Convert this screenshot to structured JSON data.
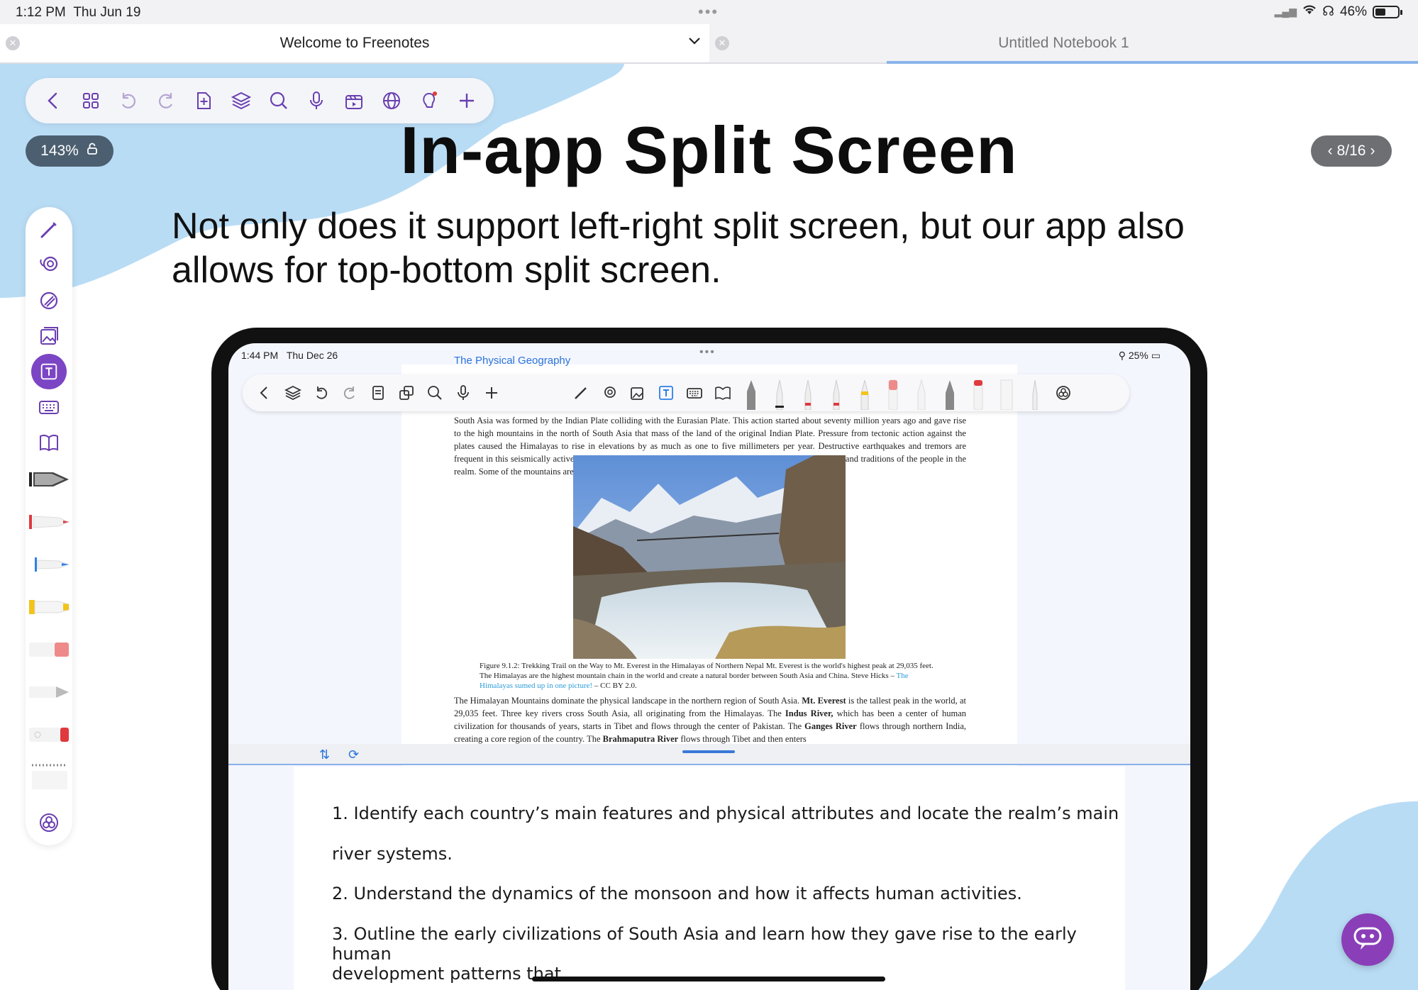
{
  "status_bar": {
    "time": "1:12 PM",
    "date": "Thu Jun 19",
    "battery": "46%"
  },
  "tabs": [
    {
      "label": "Welcome to Freenotes",
      "active": true
    },
    {
      "label": "Untitled Notebook 1",
      "active": false
    }
  ],
  "toolbar": {
    "icons": [
      "back-icon",
      "grid-icon",
      "undo-icon",
      "redo-icon",
      "add-page-icon",
      "layers-icon",
      "search-icon",
      "microphone-icon",
      "video-icon",
      "globe-icon",
      "lightbulb-icon",
      "plus-icon"
    ]
  },
  "zoom": {
    "label": "143%"
  },
  "page_indicator": {
    "label": "8/16"
  },
  "sidebar": {
    "icons": [
      "pen-icon",
      "lasso-icon",
      "shape-icon",
      "image-icon",
      "text-box-icon",
      "keyboard-icon",
      "book-icon",
      "fountain-pen-icon",
      "red-marker-icon",
      "blue-marker-icon",
      "yellow-highlighter-icon",
      "eraser-icon",
      "pencil-icon",
      "red-eraser-icon",
      "ruler-icon",
      "color-palette-icon"
    ],
    "active": "text-box-icon",
    "colors": {
      "accent": "#7b45c4",
      "red": "#e0393e",
      "blue": "#2f7ee8",
      "yellow": "#f2c418"
    }
  },
  "slide": {
    "title": "In-app Split Screen",
    "subtitle": "Not only does it support left-right split screen, but our app also allows for top-bottom split screen."
  },
  "embedded": {
    "status_time": "1:44 PM",
    "status_date": "Thu Dec 26",
    "battery": "25%",
    "doc_title": "The Physical Geography",
    "p1": "South Asia was formed by the Indian Plate colliding with the Eurasian Plate. This action started about seventy million years ago and gave rise to the high mountains in the north of South Asia that mass of the land of the original Indian Plate. Pressure from tectonic action against the plates caused the Himalayas to rise in elevations by as much as one to five millimeters per year. Destructive earthquakes and tremors are frequent in this seismically active realm. The great size of the Himalayas has intensely influenced the beliefs and traditions of the people in the realm. Some of the mountains are considered sacred to certain religions that exist here.",
    "caption_main": "Figure 9.1.2: Trekking Trail on the Way to Mt. Everest in the Himalayas of Northern Nepal Mt. Everest is the world's highest peak at 29,035 feet. The Himalayas are the highest mountain chain in the world and create a natural border between South Asia and China. Steve Hicks –",
    "caption_link": "The Himalayas sumed up in one picture!",
    "caption_license": "– CC BY 2.0.",
    "p2_a": "The Himalayan Mountains dominate the physical landscape in the northern region of South Asia.",
    "p2_b": "Mt. Everest",
    "p2_c": "is the tallest peak in the world, at 29,035 feet. Three key rivers cross South Asia, all originating from the Himalayas. The",
    "p2_d": "Indus River,",
    "p2_e": "which has been a center of human civilization for thousands of years, starts in Tibet and flows through the center of Pakistan. The",
    "p2_f": "Ganges River",
    "p2_g": "flows through northern India, creating a core region of the country. The",
    "p2_h": "Brahmaputra River",
    "p2_i": "flows through Tibet and then enters",
    "notes": [
      "1. Identify each country’s main features and physical attributes and locate the realm’s main",
      "river systems.",
      "2. Understand the dynamics of the monsoon and how it affects human activities.",
      "3. Outline the early civilizations of South Asia and learn how they gave rise to the early human",
      "development patterns that"
    ]
  },
  "colors": {
    "bg_blob": "#b9dcf5",
    "accent": "#7b45c4",
    "link": "#2b74d8"
  }
}
